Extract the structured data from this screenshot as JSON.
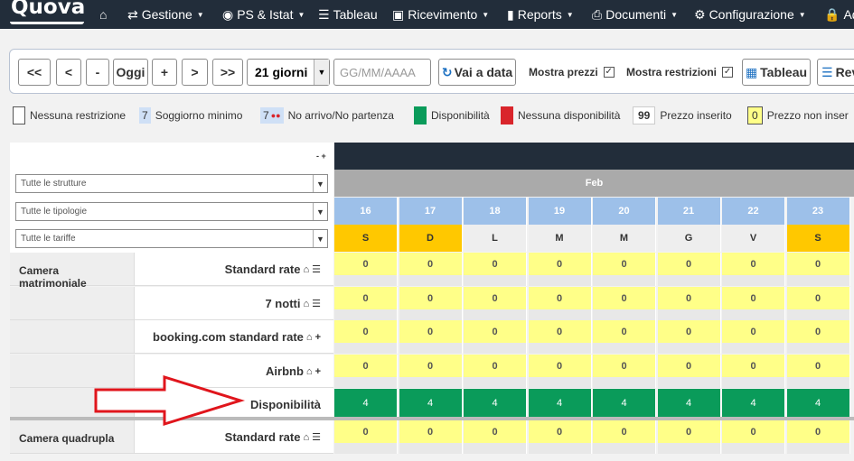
{
  "app": {
    "logo": "Quovai"
  },
  "nav": [
    {
      "icon": "home-icon",
      "label": ""
    },
    {
      "icon": "sync-icon",
      "label": "Gestione",
      "caret": true
    },
    {
      "icon": "eye-icon",
      "label": "PS & Istat",
      "caret": true
    },
    {
      "icon": "list-icon",
      "label": "Tableau",
      "caret": false
    },
    {
      "icon": "inbox-icon",
      "label": "Ricevimento",
      "caret": true
    },
    {
      "icon": "chart-icon",
      "label": "Reports",
      "caret": true
    },
    {
      "icon": "print-icon",
      "label": "Documenti",
      "caret": true
    },
    {
      "icon": "gear-icon",
      "label": "Configurazione",
      "caret": true
    },
    {
      "icon": "lock-icon",
      "label": "Ad"
    }
  ],
  "toolbar": {
    "btn_first": "<<",
    "btn_prev": "<",
    "btn_minus": "-",
    "btn_today": "Oggi",
    "btn_plus": "+",
    "btn_next": ">",
    "btn_last": ">>",
    "period": "21 giorni",
    "date_placeholder": "GG/MM/AAAA",
    "goto": "Vai a data",
    "show_prices": "Mostra prezzi",
    "show_prices_checked": true,
    "show_restrictions": "Mostra restrizioni",
    "show_restrictions_checked": true,
    "tableau": "Tableau",
    "rev": "Rev"
  },
  "legend": {
    "no_restriction": "Nessuna restrizione",
    "min_stay_num": "7",
    "min_stay": "Soggiorno minimo",
    "no_arrival_num": "7",
    "no_arrival": "No arrivo/No partenza",
    "available": "Disponibilità",
    "unavailable": "Nessuna disponibilità",
    "price_value": "99",
    "price_entered": "Prezzo inserito",
    "price_empty_value": "0",
    "price_not_entered": "Prezzo non inser",
    "colors": {
      "available": "#0a9b5a",
      "unavailable": "#d9252b",
      "min_stay": "#cfe0f6",
      "price_empty": "#ffff88"
    }
  },
  "grid": {
    "collapse": "- +",
    "filter_structures": "Tutte le strutture",
    "filter_types": "Tutte le tipologie",
    "filter_rates": "Tutte le tariffe",
    "month": "Feb",
    "days": [
      {
        "num": "16",
        "name": "S",
        "weekend": true
      },
      {
        "num": "17",
        "name": "D",
        "weekend": true
      },
      {
        "num": "18",
        "name": "L",
        "weekend": false
      },
      {
        "num": "19",
        "name": "M",
        "weekend": false
      },
      {
        "num": "20",
        "name": "M",
        "weekend": false
      },
      {
        "num": "21",
        "name": "G",
        "weekend": false
      },
      {
        "num": "22",
        "name": "V",
        "weekend": false
      },
      {
        "num": "23",
        "name": "S",
        "weekend": true
      }
    ],
    "rows": [
      {
        "category": "Camera matrimoniale",
        "rate": "Standard rate",
        "icons": "home-list",
        "values": [
          "0",
          "0",
          "0",
          "0",
          "0",
          "0",
          "0",
          "0"
        ]
      },
      {
        "category": "",
        "rate": "7 notti",
        "icons": "home-list",
        "values": [
          "0",
          "0",
          "0",
          "0",
          "0",
          "0",
          "0",
          "0"
        ]
      },
      {
        "category": "",
        "rate": "booking.com standard rate",
        "icons": "home-plus",
        "values": [
          "0",
          "0",
          "0",
          "0",
          "0",
          "0",
          "0",
          "0"
        ]
      },
      {
        "category": "",
        "rate": "Airbnb",
        "icons": "home-plus",
        "values": [
          "0",
          "0",
          "0",
          "0",
          "0",
          "0",
          "0",
          "0"
        ]
      },
      {
        "category": "",
        "rate": "Disponibilità",
        "icons": "",
        "availability": true,
        "values": [
          "4",
          "4",
          "4",
          "4",
          "4",
          "4",
          "4",
          "4"
        ]
      },
      {
        "category": "Camera quadrupla",
        "rate": "Standard rate",
        "icons": "home-list",
        "values": [
          "0",
          "0",
          "0",
          "0",
          "0",
          "0",
          "0",
          "0"
        ]
      }
    ]
  }
}
